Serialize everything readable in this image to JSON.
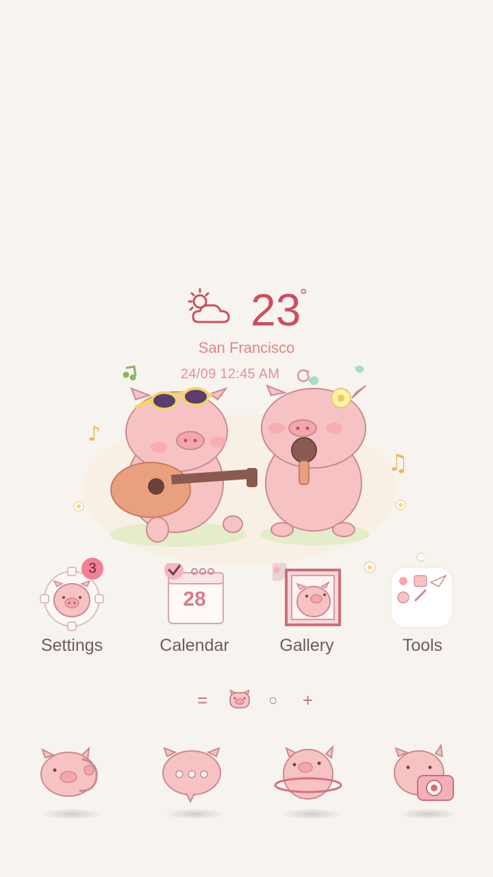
{
  "weather": {
    "icon": "partly-cloudy-icon",
    "temperature": "23",
    "degree_symbol": "°",
    "city": "San Francisco",
    "datetime": "24/09 12:45 AM",
    "refresh_icon": "refresh-icon"
  },
  "apps": [
    {
      "label": "Settings",
      "icon": "pig-gear-icon",
      "badge": "3"
    },
    {
      "label": "Calendar",
      "icon": "calendar-icon",
      "day": "28"
    },
    {
      "label": "Gallery",
      "icon": "pig-photo-frame-icon"
    },
    {
      "label": "Tools",
      "icon": "tools-folder-icon"
    }
  ],
  "page_indicator": {
    "items": [
      "=",
      "pig-home-icon",
      "○",
      "+"
    ]
  },
  "dock": [
    {
      "icon": "pig-phone-icon"
    },
    {
      "icon": "pig-messages-icon"
    },
    {
      "icon": "pig-planet-browser-icon"
    },
    {
      "icon": "pig-camera-icon"
    }
  ],
  "colors": {
    "background": "#f7f3ee",
    "accent": "#c9505f",
    "pig_pink": "#f6c2c4",
    "outline": "#c98a8f",
    "label": "#6e5b5b"
  }
}
